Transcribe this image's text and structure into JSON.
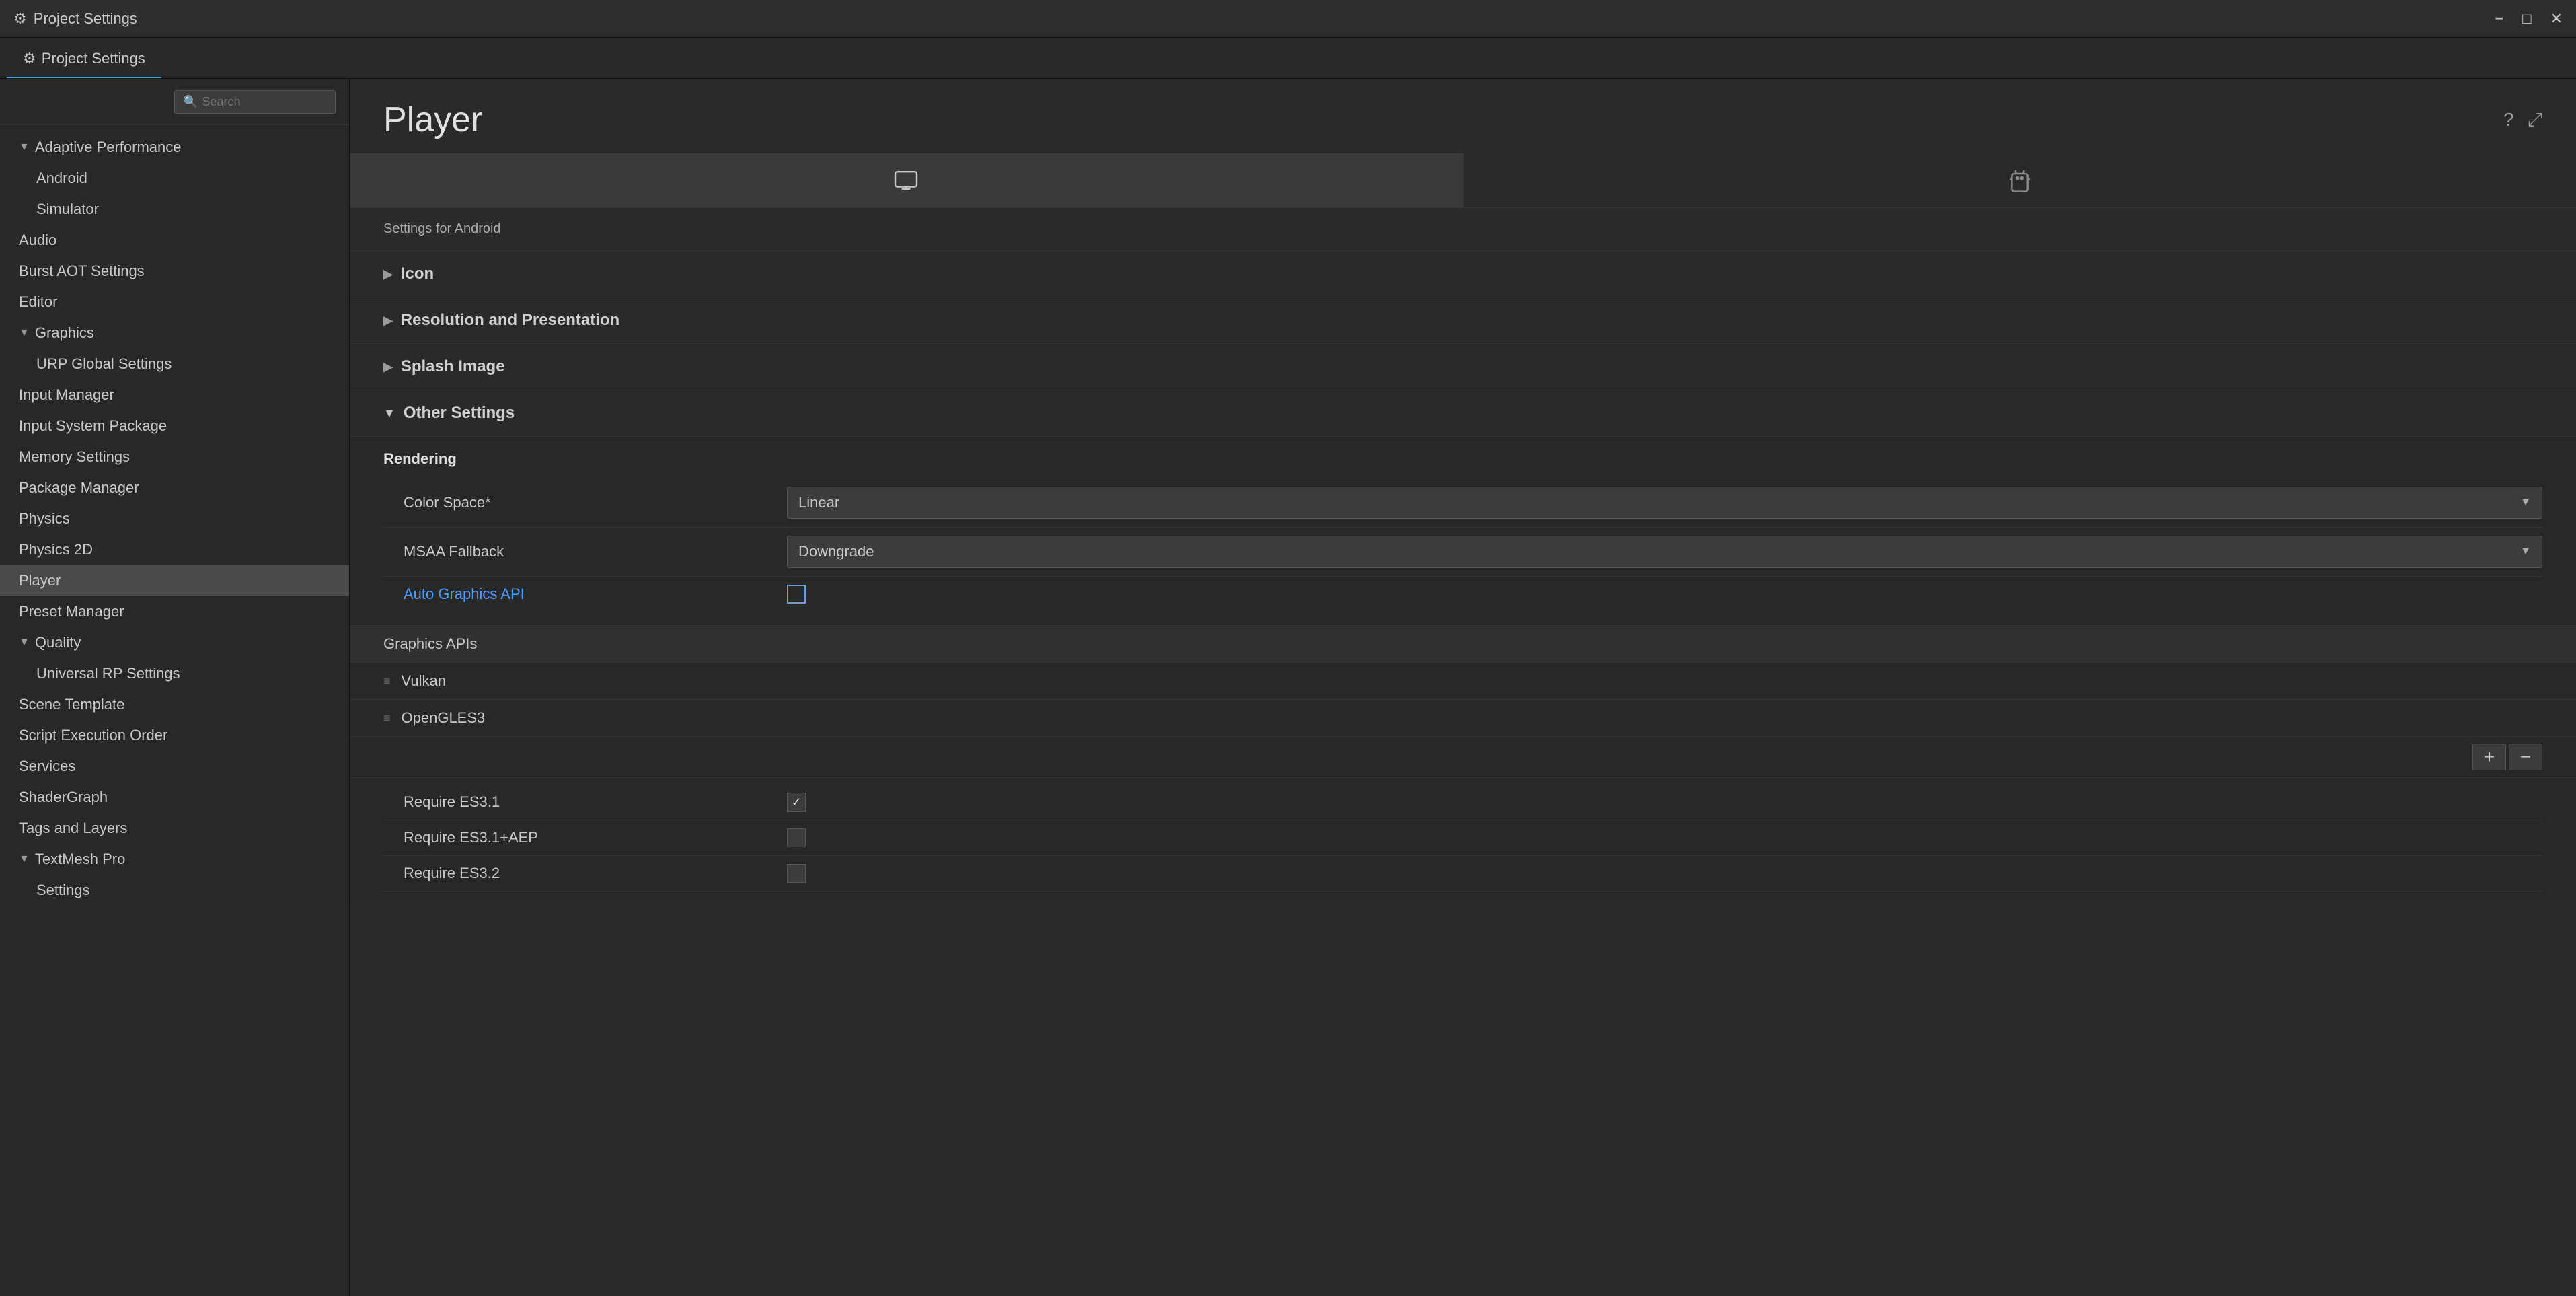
{
  "titleBar": {
    "icon": "⚙",
    "title": "Project Settings",
    "minimizeLabel": "−",
    "maximizeLabel": "□",
    "closeLabel": "✕"
  },
  "tabBar": {
    "tabs": [
      {
        "label": "Project Settings",
        "icon": "⚙",
        "active": true
      }
    ]
  },
  "sidebar": {
    "searchPlaceholder": "Search",
    "items": [
      {
        "label": "Adaptive Performance",
        "type": "parent",
        "expanded": true
      },
      {
        "label": "Android",
        "type": "child"
      },
      {
        "label": "Simulator",
        "type": "child"
      },
      {
        "label": "Audio",
        "type": "item"
      },
      {
        "label": "Burst AOT Settings",
        "type": "item"
      },
      {
        "label": "Editor",
        "type": "item"
      },
      {
        "label": "Graphics",
        "type": "parent",
        "expanded": true
      },
      {
        "label": "URP Global Settings",
        "type": "child"
      },
      {
        "label": "Input Manager",
        "type": "item"
      },
      {
        "label": "Input System Package",
        "type": "item"
      },
      {
        "label": "Memory Settings",
        "type": "item"
      },
      {
        "label": "Package Manager",
        "type": "item"
      },
      {
        "label": "Physics",
        "type": "item"
      },
      {
        "label": "Physics 2D",
        "type": "item"
      },
      {
        "label": "Player",
        "type": "item",
        "active": true
      },
      {
        "label": "Preset Manager",
        "type": "item"
      },
      {
        "label": "Quality",
        "type": "parent",
        "expanded": true
      },
      {
        "label": "Universal RP Settings",
        "type": "child"
      },
      {
        "label": "Scene Template",
        "type": "item"
      },
      {
        "label": "Script Execution Order",
        "type": "item"
      },
      {
        "label": "Services",
        "type": "item"
      },
      {
        "label": "ShaderGraph",
        "type": "item"
      },
      {
        "label": "Tags and Layers",
        "type": "item"
      },
      {
        "label": "TextMesh Pro",
        "type": "parent",
        "expanded": true
      },
      {
        "label": "Settings",
        "type": "child"
      }
    ]
  },
  "content": {
    "title": "Player",
    "helpIcon": "?",
    "expandIcon": "⤢",
    "platformTabs": [
      {
        "icon": "🖥",
        "label": "Desktop",
        "active": true
      },
      {
        "icon": "🤖",
        "label": "Android",
        "active": false
      }
    ],
    "settingsForLabel": "Settings for Android",
    "sections": [
      {
        "id": "icon",
        "label": "Icon",
        "expanded": false
      },
      {
        "id": "resolution",
        "label": "Resolution and Presentation",
        "expanded": false
      },
      {
        "id": "splash",
        "label": "Splash Image",
        "expanded": false
      },
      {
        "id": "other",
        "label": "Other Settings",
        "expanded": true
      }
    ],
    "otherSettings": {
      "rendering": {
        "label": "Rendering",
        "rows": [
          {
            "label": "Color Space*",
            "type": "dropdown",
            "value": "Linear",
            "isLink": false
          },
          {
            "label": "MSAA Fallback",
            "type": "dropdown",
            "value": "Downgrade",
            "isLink": false
          },
          {
            "label": "Auto Graphics API",
            "type": "checkbox",
            "checked": false,
            "isLink": true
          }
        ]
      },
      "graphicsAPIs": {
        "label": "Graphics APIs",
        "items": [
          {
            "label": "Vulkan"
          },
          {
            "label": "OpenGLES3"
          }
        ],
        "addLabel": "+",
        "removeLabel": "−"
      },
      "requireRows": [
        {
          "label": "Require ES3.1",
          "checked": true
        },
        {
          "label": "Require ES3.1+AEP",
          "checked": false
        },
        {
          "label": "Require ES3.2",
          "checked": false
        }
      ]
    }
  }
}
